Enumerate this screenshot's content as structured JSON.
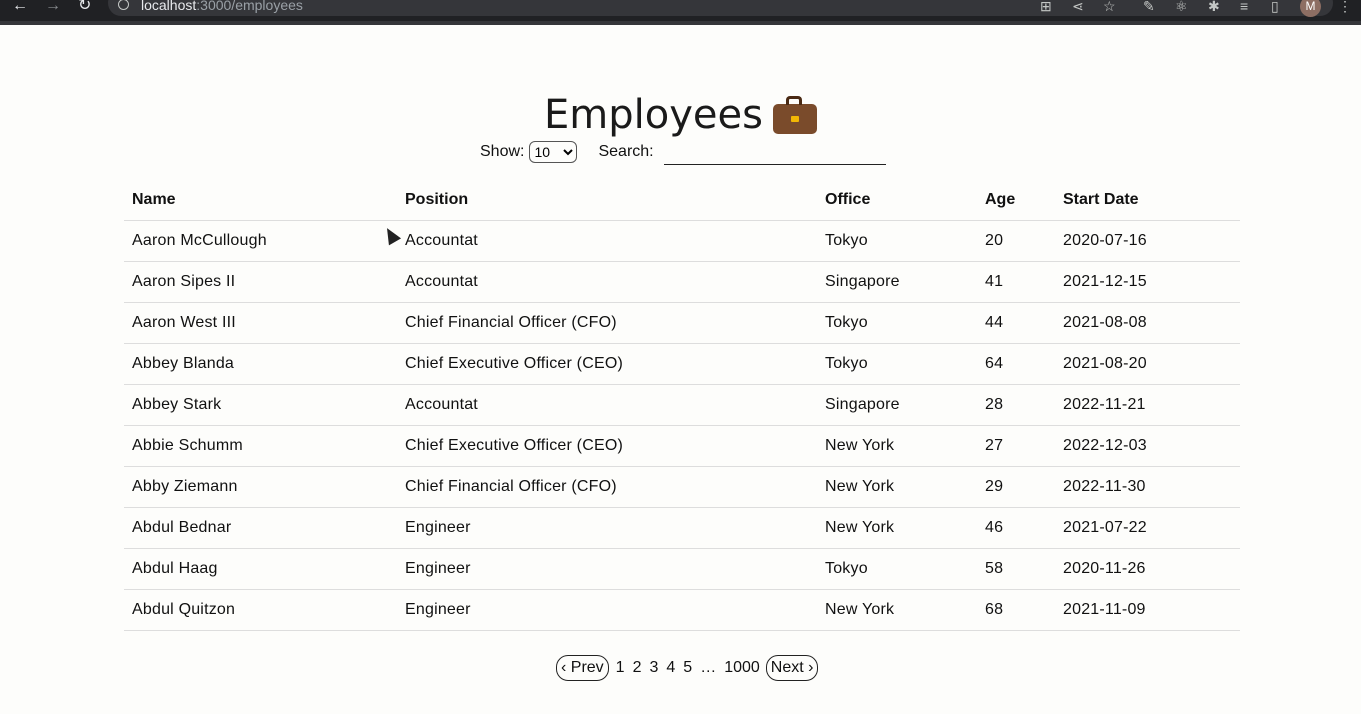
{
  "browser": {
    "url_host": "localhost",
    "url_path": ":3000/employees",
    "avatar_letter": "M"
  },
  "page": {
    "title": "Employees"
  },
  "controls": {
    "show_label": "Show:",
    "show_value": "10",
    "search_label": "Search:",
    "search_value": ""
  },
  "table": {
    "columns": [
      "Name",
      "Position",
      "Office",
      "Age",
      "Start Date"
    ],
    "rows": [
      [
        "Aaron McCullough",
        "Accountat",
        "Tokyo",
        "20",
        "2020-07-16"
      ],
      [
        "Aaron Sipes II",
        "Accountat",
        "Singapore",
        "41",
        "2021-12-15"
      ],
      [
        "Aaron West III",
        "Chief Financial Officer (CFO)",
        "Tokyo",
        "44",
        "2021-08-08"
      ],
      [
        "Abbey Blanda",
        "Chief Executive Officer (CEO)",
        "Tokyo",
        "64",
        "2021-08-20"
      ],
      [
        "Abbey Stark",
        "Accountat",
        "Singapore",
        "28",
        "2022-11-21"
      ],
      [
        "Abbie Schumm",
        "Chief Executive Officer (CEO)",
        "New York",
        "27",
        "2022-12-03"
      ],
      [
        "Abby Ziemann",
        "Chief Financial Officer (CFO)",
        "New York",
        "29",
        "2022-11-30"
      ],
      [
        "Abdul Bednar",
        "Engineer",
        "New York",
        "46",
        "2021-07-22"
      ],
      [
        "Abdul Haag",
        "Engineer",
        "Tokyo",
        "58",
        "2020-11-26"
      ],
      [
        "Abdul Quitzon",
        "Engineer",
        "New York",
        "68",
        "2021-11-09"
      ]
    ]
  },
  "pagination": {
    "prev_label": "‹ Prev",
    "next_label": "Next ›",
    "pages": [
      "1",
      "2",
      "3",
      "4",
      "5"
    ],
    "ellipsis": "…",
    "last_page": "1000"
  }
}
